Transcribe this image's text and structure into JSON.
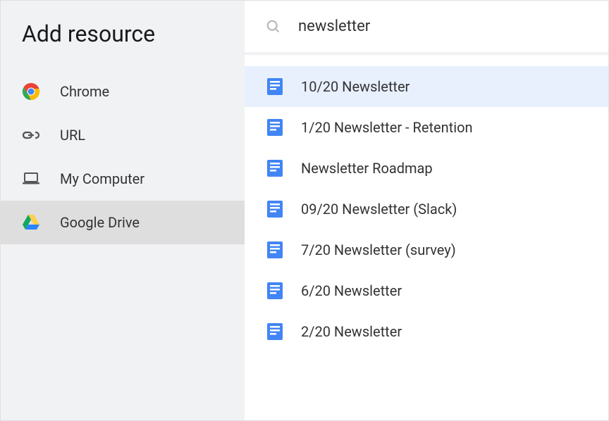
{
  "sidebar": {
    "title": "Add resource",
    "items": [
      {
        "label": "Chrome",
        "icon": "chrome",
        "selected": false
      },
      {
        "label": "URL",
        "icon": "link",
        "selected": false
      },
      {
        "label": "My Computer",
        "icon": "laptop",
        "selected": false
      },
      {
        "label": "Google Drive",
        "icon": "drive",
        "selected": true
      }
    ]
  },
  "search": {
    "value": "newsletter",
    "placeholder": "Search"
  },
  "results": [
    {
      "label": "10/20 Newsletter",
      "icon": "doc",
      "selected": true
    },
    {
      "label": "1/20 Newsletter - Retention",
      "icon": "doc",
      "selected": false
    },
    {
      "label": "Newsletter Roadmap",
      "icon": "doc",
      "selected": false
    },
    {
      "label": "09/20 Newsletter (Slack)",
      "icon": "doc",
      "selected": false
    },
    {
      "label": "7/20 Newsletter (survey)",
      "icon": "doc",
      "selected": false
    },
    {
      "label": "6/20 Newsletter",
      "icon": "doc",
      "selected": false
    },
    {
      "label": "2/20 Newsletter",
      "icon": "doc",
      "selected": false
    }
  ]
}
